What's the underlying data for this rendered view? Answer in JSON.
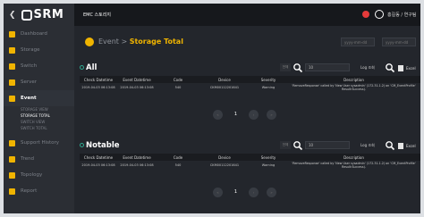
{
  "sidebar": {
    "logo": "SRM",
    "items": [
      {
        "label": "Dashboard",
        "color": "#f0b400",
        "active": false
      },
      {
        "label": "Storage",
        "color": "#f0b400",
        "active": false
      },
      {
        "label": "Switch",
        "color": "#f0b400",
        "active": false
      },
      {
        "label": "Server",
        "color": "#f0b400",
        "active": false
      },
      {
        "label": "Event",
        "color": "#f0b400",
        "active": true
      }
    ],
    "sub_items": [
      "STORAGE VIEW",
      "STORAGE TOTAL",
      "SWITCH VIEW",
      "SWITCH TOTAL"
    ],
    "active_sub": 1,
    "items_bottom": [
      {
        "label": "Support History",
        "color": "#f0b400"
      },
      {
        "label": "Trend",
        "color": "#f0b400"
      },
      {
        "label": "Topology",
        "color": "#f0b400"
      },
      {
        "label": "Report",
        "color": "#f0b400"
      }
    ]
  },
  "topbar": {
    "tab": "EMC 스토리지",
    "user": "홍길동 / 연구팀"
  },
  "header": {
    "crumb_parent": "Event",
    "crumb_current": "Storage Total",
    "date_from": "yyyy-mm-dd",
    "date_to": "yyyy-mm-dd"
  },
  "sections": [
    {
      "title": "All",
      "select": "전체",
      "input_value": "10",
      "log_label": "Log 조회",
      "excel_label": "Excel",
      "columns": [
        "Check Datetime",
        "Event Datetime",
        "Code",
        "Device",
        "Severity",
        "Description"
      ],
      "rows": [
        {
          "check": "2019-04-03 06:13:08",
          "event": "2019-04-03 06:13:08",
          "code": "540",
          "device": "CKM00112201641",
          "severity": "Warning",
          "desc": "'RemoveResponse' called by 'New User sysadmin' (172.31.1.2) on 'CM_EventProfile' Result:Success)."
        }
      ],
      "page": "1"
    },
    {
      "title": "Notable",
      "select": "전체",
      "input_value": "10",
      "log_label": "Log 조회",
      "excel_label": "Excel",
      "columns": [
        "Check Datetime",
        "Event Datetime",
        "Code",
        "Device",
        "Severity",
        "Description"
      ],
      "rows": [
        {
          "check": "2019-04-03 06:13:08",
          "event": "2019-04-03 06:13:08",
          "code": "540",
          "device": "CKM00112201641",
          "severity": "Warning",
          "desc": "'RemoveResponse' called by 'New User sysadmin' (172.31.1.2) on 'CM_EventProfile' Result:Success)."
        }
      ],
      "page": "1"
    }
  ]
}
